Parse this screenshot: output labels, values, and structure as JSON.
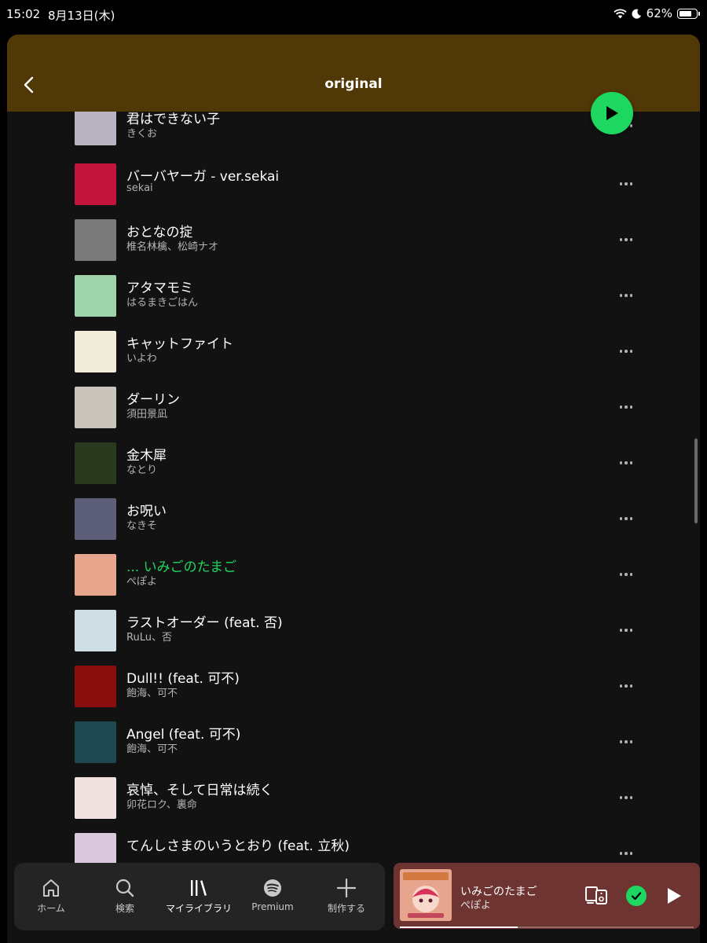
{
  "status_bar": {
    "time": "15:02",
    "date": "8月13日(木)",
    "battery": "62%"
  },
  "header": {
    "title": "original"
  },
  "tracks": [
    {
      "title": "君はできない子",
      "artist": "きくお",
      "cover_color": "#b9b3c2"
    },
    {
      "title": "バーバヤーガ - ver.sekai",
      "artist": "sekai",
      "cover_color": "#c2143c"
    },
    {
      "title": "おとなの掟",
      "artist": "椎名林檎、松崎ナオ",
      "cover_color": "#7a7a7a"
    },
    {
      "title": "アタマモミ",
      "artist": "はるまきごはん",
      "cover_color": "#9fd3a9"
    },
    {
      "title": "キャットファイト",
      "artist": "いよわ",
      "cover_color": "#f1ebd9"
    },
    {
      "title": "ダーリン",
      "artist": "須田景凪",
      "cover_color": "#c9c4bb"
    },
    {
      "title": "金木犀",
      "artist": "なとり",
      "cover_color": "#2a3a1e"
    },
    {
      "title": "お呪い",
      "artist": "なきそ",
      "cover_color": "#5d5f78"
    },
    {
      "title": "... いみごのたまご",
      "artist": "ぺぽよ",
      "cover_color": "#e8a58e",
      "playing": true
    },
    {
      "title": "ラストオーダー (feat. 否)",
      "artist": "RuLu、否",
      "cover_color": "#cfdde4"
    },
    {
      "title": "Dull!! (feat. 可不)",
      "artist": "飽海、可不",
      "cover_color": "#8a0e0e"
    },
    {
      "title": "Angel (feat. 可不)",
      "artist": "飽海、可不",
      "cover_color": "#1e4750"
    },
    {
      "title": "哀悼、そして日常は続く",
      "artist": "卯花ロク、裏命",
      "cover_color": "#f1e1e1"
    },
    {
      "title": "てんしさまのいうとおり (feat. 立秋)",
      "artist": "",
      "cover_color": "#d9c7dc"
    }
  ],
  "bottom_nav": [
    {
      "label": "ホーム",
      "icon": "home-icon"
    },
    {
      "label": "検索",
      "icon": "search-icon"
    },
    {
      "label": "マイライブラリ",
      "icon": "library-icon",
      "active": true
    },
    {
      "label": "Premium",
      "icon": "spotify-icon"
    },
    {
      "label": "制作する",
      "icon": "plus-icon"
    }
  ],
  "now_playing": {
    "title": "いみごのたまご",
    "artist": "ぺぽよ",
    "progress": 0.4
  },
  "colors": {
    "accent": "#1ed760",
    "header_bg": "#513907",
    "miniplayer_bg": "#6e3431",
    "background": "#121212"
  }
}
